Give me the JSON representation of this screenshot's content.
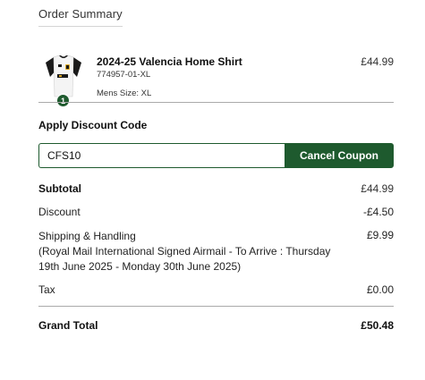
{
  "summary": {
    "title": "Order Summary"
  },
  "product": {
    "name": "2024-25 Valencia Home Shirt",
    "sku": "774957-01-XL",
    "size": "Mens Size:  XL",
    "price": "£44.99",
    "quantity": "1",
    "image_icon": "football-shirt-icon"
  },
  "discount": {
    "heading": "Apply Discount Code",
    "code_value": "CFS10",
    "button_label": "Cancel Coupon"
  },
  "totals": {
    "subtotal_label": "Subtotal",
    "subtotal_value": "£44.99",
    "discount_label": "Discount",
    "discount_value": "-£4.50",
    "shipping_label": "Shipping & Handling",
    "shipping_detail_line1": "(Royal Mail International Signed Airmail - To Arrive : Thursday",
    "shipping_detail_line2": "19th June 2025 - Monday 30th June 2025)",
    "shipping_value": "£9.99",
    "tax_label": "Tax",
    "tax_value": "£0.00",
    "grand_total_label": "Grand Total",
    "grand_total_value": "£50.48"
  },
  "colors": {
    "brand_green": "#1e5a2e",
    "divider": "#aaaaaa"
  }
}
